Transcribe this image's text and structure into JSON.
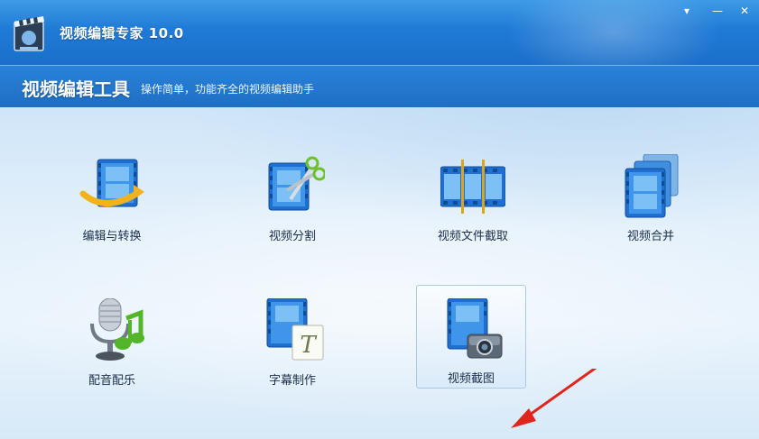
{
  "window": {
    "title": "视频编辑专家 10.0",
    "controls": {
      "menu": "▾",
      "minimize": "—",
      "close": "✕"
    }
  },
  "header": {
    "title": "视频编辑工具",
    "subtitle": "操作简单，功能齐全的视频编辑助手"
  },
  "tools": [
    {
      "label": "编辑与转换",
      "icon": "film-convert-icon"
    },
    {
      "label": "视频分割",
      "icon": "film-scissors-icon"
    },
    {
      "label": "视频文件截取",
      "icon": "film-strip-cut-icon"
    },
    {
      "label": "视频合并",
      "icon": "film-merge-icon"
    },
    {
      "label": "配音配乐",
      "icon": "microphone-music-icon"
    },
    {
      "label": "字幕制作",
      "icon": "film-subtitle-icon"
    },
    {
      "label": "视频截图",
      "icon": "film-camera-icon"
    }
  ],
  "selected_tool": "视频截图",
  "colors": {
    "titlebar": "#1f7ad6",
    "header": "#1e6fc4",
    "film_blue": "#1f6fd0",
    "arrow_red": "#e0261c"
  }
}
